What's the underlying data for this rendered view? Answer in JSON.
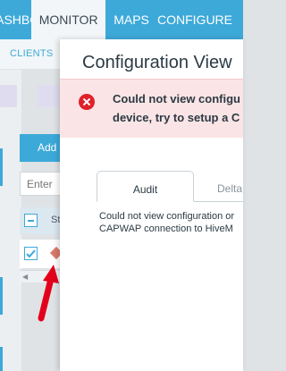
{
  "topnav": {
    "items": [
      "DASHBOARD",
      "MONITOR",
      "MAPS",
      "CONFIGURE"
    ],
    "active": "MONITOR"
  },
  "subnav": {
    "tabs": [
      "CLIENTS"
    ]
  },
  "toolbar": {
    "add_label": "Add",
    "filter_placeholder": "Enter"
  },
  "table": {
    "column_header": "St"
  },
  "modal": {
    "title": "Configuration View",
    "error": {
      "line1": "Could not view configu",
      "line2": "device, try to setup a C"
    },
    "tabs": [
      "Audit",
      "Delta"
    ],
    "active_tab": "Audit",
    "description": {
      "line1": "Could not view configuration or",
      "line2": "CAPWAP connection to HiveM"
    }
  },
  "colors": {
    "accent": "#3da9d9",
    "error_bg": "#fbe4e5",
    "error_icon": "#e0202a",
    "pointer_arrow": "#e3001b"
  }
}
